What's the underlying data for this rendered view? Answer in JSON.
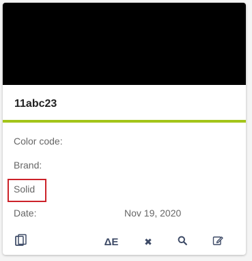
{
  "card": {
    "swatch_color": "#000000",
    "accent_color": "#a3c51a",
    "title": "11abc23",
    "fields": {
      "color_code_label": "Color code:",
      "brand_label": "Brand:",
      "finish": "Solid",
      "date_label": "Date:",
      "date_value": "Nov 19, 2020"
    },
    "highlight_color": "#cc2229"
  },
  "actions": {
    "delta_label": "ΔE",
    "remove_label": "✖",
    "icons": [
      "copy-icon",
      "delta-e",
      "remove-icon",
      "search-icon",
      "edit-icon"
    ]
  }
}
